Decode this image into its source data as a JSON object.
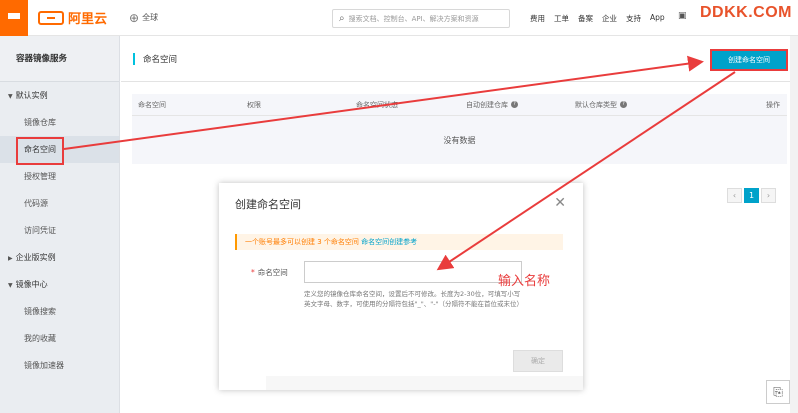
{
  "topbar": {
    "logo_text": "阿里云",
    "region_label": "全球",
    "search_placeholder": "搜索文档、控制台、API、解决方案和资源",
    "links": [
      "费用",
      "工单",
      "备案",
      "企业",
      "支持",
      "App"
    ],
    "watermark": "DDKK.COM"
  },
  "sidebar": {
    "title": "容器镜像服务",
    "group_default": "默认实例",
    "item_repos": "镜像仓库",
    "item_namespace": "命名空间",
    "item_auth": "授权管理",
    "item_source": "代码源",
    "item_credential": "访问凭证",
    "group_enterprise": "企业版实例",
    "group_center": "镜像中心",
    "item_search": "镜像搜索",
    "item_favorites": "我的收藏",
    "item_accelerator": "镜像加速器"
  },
  "main": {
    "title": "命名空间",
    "create_button": "创建命名空间",
    "columns": [
      "命名空间",
      "权限",
      "命名空间状态",
      "自动创建仓库",
      "默认仓库类型",
      "操作"
    ],
    "empty_text": "没有数据",
    "pager_current": "1"
  },
  "modal": {
    "title": "创建命名空间",
    "tip_text": "一个账号最多可以创建 3 个命名空间",
    "tip_link": "命名空间创建参考",
    "label": "命名空间",
    "help_text": "定义您的镜像仓库命名空间，设置后不可修改。长度为2-30位，可填写小写英文字母、数字，可使用的分隔符包括\"_\"、\"-\"（分隔符不能在首位或末位）",
    "ok_button": "确定"
  },
  "annotation": "输入名称",
  "colors": {
    "brand": "#ff6a00",
    "accent": "#00a2ca",
    "annotation_red": "#e93c3c"
  }
}
